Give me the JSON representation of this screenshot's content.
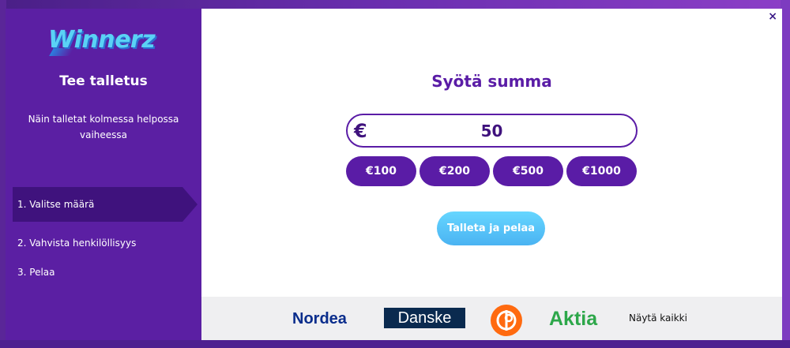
{
  "colors": {
    "sidebar_bg": "#5b1fa3",
    "active_step_bg": "#3f127d",
    "primary_purple": "#5a1ca6",
    "cta_blue": "#4ab3f2",
    "bank_bar_bg": "#efeff1"
  },
  "sidebar": {
    "logo_text": "Winnerz",
    "title": "Tee talletus",
    "subtitle": "Näin talletat kolmessa helpossa vaiheessa",
    "steps": [
      {
        "label": "1. Valitse määrä",
        "active": true
      },
      {
        "label": "2. Vahvista henkilöllisyys",
        "active": false
      },
      {
        "label": "3. Pelaa",
        "active": false
      }
    ]
  },
  "main": {
    "close_icon": "×",
    "heading": "Syötä summa",
    "currency_symbol": "€",
    "amount_value": "50",
    "presets": [
      "€100",
      "€200",
      "€500",
      "€1000"
    ],
    "cta_label": "Talleta ja pelaa"
  },
  "banks": {
    "items": [
      "Nordea",
      "Danske",
      "OP",
      "Aktia"
    ],
    "show_all_label": "Näytä kaikki"
  }
}
